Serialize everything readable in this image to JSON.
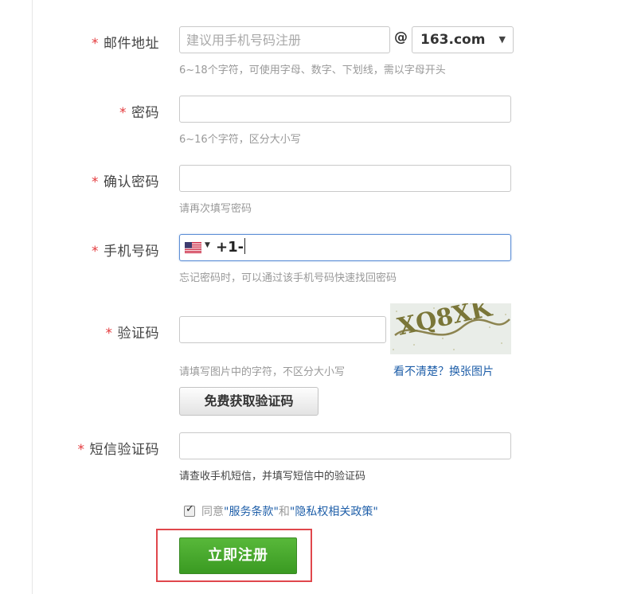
{
  "fields": {
    "email": {
      "label": "邮件地址",
      "required_mark": "*",
      "placeholder": "建议用手机号码注册",
      "at_symbol": "@",
      "domain": "163.com",
      "hint": "6~18个字符，可使用字母、数字、下划线，需以字母开头"
    },
    "password": {
      "label": "密码",
      "required_mark": "*",
      "hint": "6~16个字符，区分大小写"
    },
    "confirm_password": {
      "label": "确认密码",
      "required_mark": "*",
      "hint": "请再次填写密码"
    },
    "phone": {
      "label": "手机号码",
      "required_mark": "*",
      "country_flag": "us-flag-icon",
      "value": "+1-",
      "hint": "忘记密码时，可以通过该手机号码快速找回密码"
    },
    "captcha": {
      "label": "验证码",
      "required_mark": "*",
      "image_text": "XQ8XK",
      "hint": "请填写图片中的字符，不区分大小写",
      "refresh_link": "看不清楚？换张图片"
    },
    "get_code_button": "免费获取验证码",
    "sms_code": {
      "label": "短信验证码",
      "required_mark": "*",
      "hint": "请查收手机短信，并填写短信中的验证码"
    }
  },
  "agreement": {
    "checked": true,
    "prefix": "同意",
    "terms_link": "\"服务条款\"",
    "and": "和",
    "privacy_link": "\"隐私权相关政策\""
  },
  "submit_button": "立即注册",
  "colors": {
    "required": "#e4393c",
    "link": "#1f5fa9",
    "submit_green": "#4aa82e",
    "highlight_red": "#e0474c",
    "focus_blue": "#5d8fd6"
  }
}
